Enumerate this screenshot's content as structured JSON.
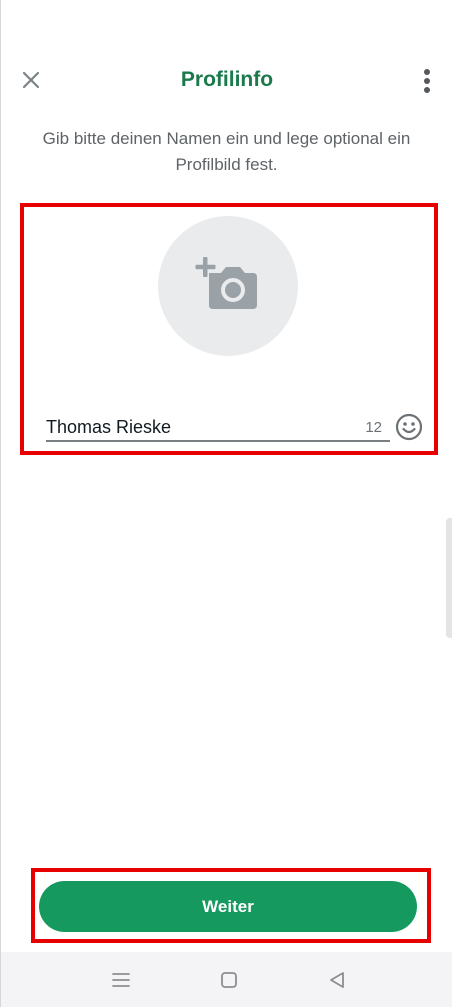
{
  "header": {
    "title": "Profilinfo",
    "close_icon": "close-icon",
    "menu_icon": "more-vert-icon"
  },
  "subtitle": "Gib bitte deinen Namen ein und lege optional ein Profilbild fest.",
  "profile": {
    "avatar_icon": "add-photo-camera-icon",
    "name_value": "Thomas Rieske",
    "char_count": "12",
    "emoji_icon": "emoji-smiley-icon"
  },
  "footer": {
    "button_label": "Weiter"
  },
  "navbar": {
    "menu_icon": "nav-menu-icon",
    "home_icon": "nav-home-icon",
    "back_icon": "nav-back-icon"
  },
  "colors": {
    "accent": "#1b7a4c",
    "button": "#15995e",
    "highlight": "#e60000"
  }
}
